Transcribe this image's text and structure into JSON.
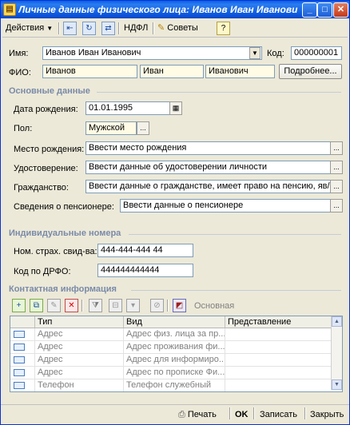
{
  "window": {
    "title": "Личные данные физического лица: Иванов Иван Иванович",
    "minimize": "_",
    "maximize": "□",
    "close": "✕"
  },
  "toolbar": {
    "actions_label": "Действия",
    "ndfl_label": "НДФЛ",
    "tips_label": "Советы",
    "help_label": "?"
  },
  "form": {
    "name_label": "Имя:",
    "name_value": "Иванов Иван Иванович",
    "code_label": "Код:",
    "code_value": "000000001",
    "fio_label": "ФИО:",
    "last_name": "Иванов",
    "first_name": "Иван",
    "middle_name": "Иванович",
    "more_button": "Подробнее..."
  },
  "basic": {
    "section_title": "Основные данные",
    "birth_date_label": "Дата рождения:",
    "birth_date_value": "01.01.1995",
    "gender_label": "Пол:",
    "gender_value": "Мужской",
    "birth_place_label": "Место рождения:",
    "birth_place_value": "Ввести место рождения",
    "id_doc_label": "Удостоверение:",
    "id_doc_value": "Ввести данные об удостоверении личности",
    "citizenship_label": "Гражданство:",
    "citizenship_value": "Ввести данные о гражданстве, имеет право на пенсию, яв/",
    "pensioner_label": "Сведения о пенсионере:",
    "pensioner_value": "Ввести данные о пенсионере"
  },
  "ids": {
    "section_title": "Индивидуальные номера",
    "insurance_label": "Ном. страх. свид-ва:",
    "insurance_value": "444-444-444 44",
    "drfo_label": "Код по ДРФО:",
    "drfo_value": "444444444444"
  },
  "contacts": {
    "section_title": "Контактная информация",
    "main_label": "Основная",
    "columns": [
      "Тип",
      "Вид",
      "Представление"
    ],
    "rows": [
      {
        "type": "Адрес",
        "kind": "Адрес физ. лица за пр...",
        "view": ""
      },
      {
        "type": "Адрес",
        "kind": "Адрес проживания фи...",
        "view": ""
      },
      {
        "type": "Адрес",
        "kind": "Адрес для информиро...",
        "view": ""
      },
      {
        "type": "Адрес",
        "kind": "Адрес по прописке Фи...",
        "view": ""
      },
      {
        "type": "Телефон",
        "kind": "Телефон служебный",
        "view": ""
      }
    ]
  },
  "footer": {
    "print_label": "Печать",
    "ok_label": "OK",
    "save_label": "Записать",
    "close_label": "Закрыть"
  }
}
